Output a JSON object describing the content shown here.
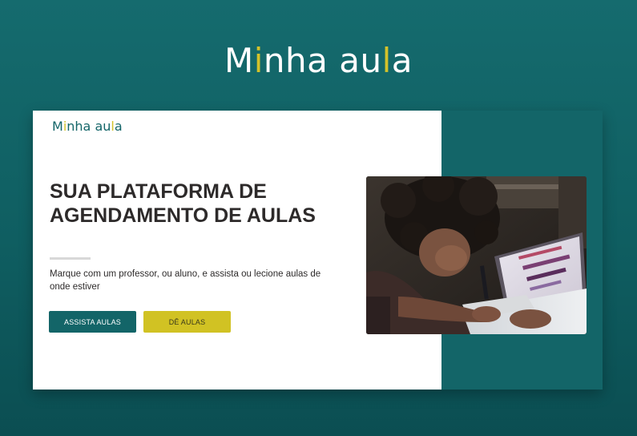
{
  "page": {
    "brand": {
      "prefix": "M",
      "highlight_1": "i",
      "middle": "nha au",
      "highlight_2": "l",
      "suffix": "a"
    }
  },
  "card": {
    "logo": {
      "prefix": "M",
      "highlight_1": "i",
      "middle": "nha au",
      "highlight_2": "l",
      "suffix": "a"
    },
    "headline": "SUA PLATAFORMA DE AGENDAMENTO DE AULAS",
    "description": "Marque com um professor, ou aluno, e assista ou lecione aulas de onde estiver",
    "primary_button": "ASSISTA AULAS",
    "secondary_button": "DÊ AULAS",
    "hero_image_icon": "student-laptop-photo"
  },
  "colors": {
    "teal": "#136568",
    "accent": "#d1c223",
    "text": "#2d2a2a"
  }
}
